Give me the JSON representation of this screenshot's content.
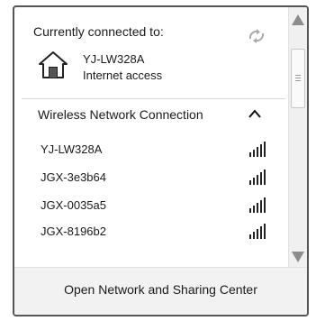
{
  "connection": {
    "heading": "Currently connected to:",
    "network_name": "YJ-LW328A",
    "access_status": "Internet access"
  },
  "wireless": {
    "section_title": "Wireless Network Connection",
    "networks": [
      {
        "name": "YJ-LW328A",
        "signal": "full"
      },
      {
        "name": "JGX-3e3b64",
        "signal": "full"
      },
      {
        "name": "JGX-0035a5",
        "signal": "full"
      },
      {
        "name": "JGX-8196b2",
        "signal": "full"
      }
    ]
  },
  "footer": {
    "link_label": "Open Network and Sharing Center"
  },
  "icons": {
    "refresh": "refresh-icon",
    "house": "house-icon",
    "collapse": "chevron-up-icon",
    "signal": "signal-bars-icon"
  }
}
